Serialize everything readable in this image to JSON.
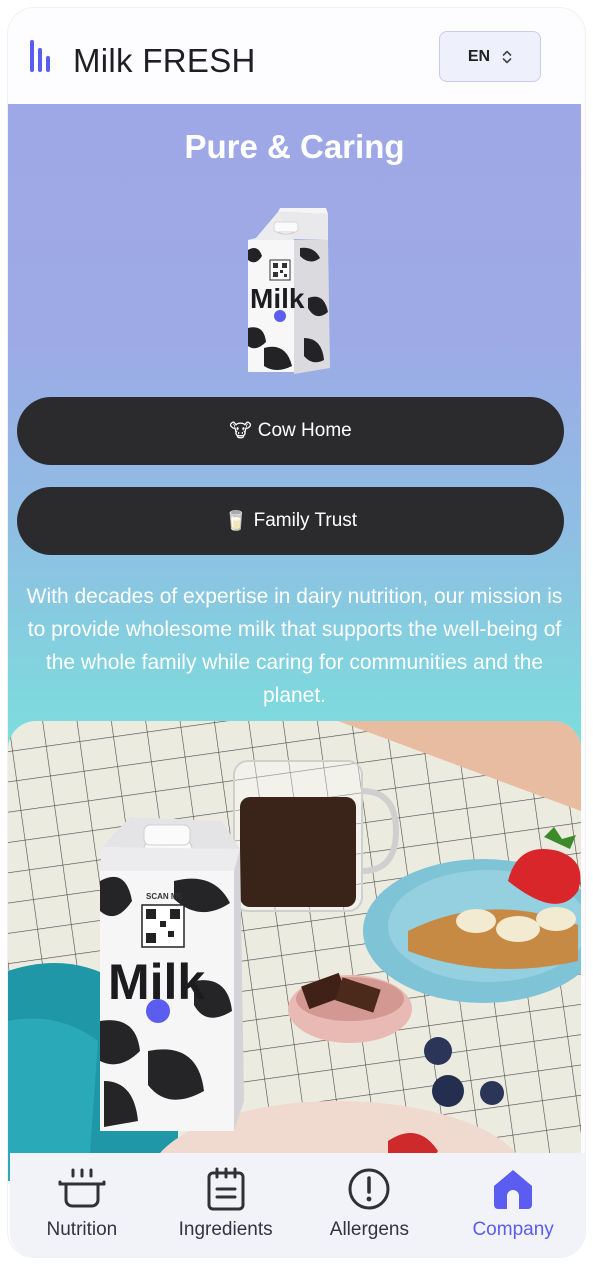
{
  "header": {
    "brand": "Milk FRESH",
    "logo_icon": "bars-logo-icon",
    "language": {
      "value": "EN",
      "icon": "chevron-updown-icon"
    }
  },
  "hero": {
    "title": "Pure & Caring",
    "product_image": "milk-carton",
    "buttons": [
      {
        "emoji": "🐮",
        "label": "Cow Home"
      },
      {
        "emoji": "🥛",
        "label": "Family Trust"
      }
    ],
    "mission": "With decades of expertise in dairy nutrition, our mission is to provide wholesome milk that supports the well-being of the whole family while caring for communities and the planet."
  },
  "carton": {
    "brand_text": "Milk",
    "qr_caption": "SCAN ME"
  },
  "nav": {
    "items": [
      {
        "label": "Nutrition",
        "icon": "pot-icon",
        "active": false
      },
      {
        "label": "Ingredients",
        "icon": "notepad-icon",
        "active": false
      },
      {
        "label": "Allergens",
        "icon": "alert-circle-icon",
        "active": false
      },
      {
        "label": "Company",
        "icon": "home-icon",
        "active": true
      }
    ]
  },
  "colors": {
    "accent": "#5b5cf0",
    "pill": "#2b2b2d",
    "gradient_top": "#9ea8e6",
    "gradient_bottom": "#76e2da"
  }
}
